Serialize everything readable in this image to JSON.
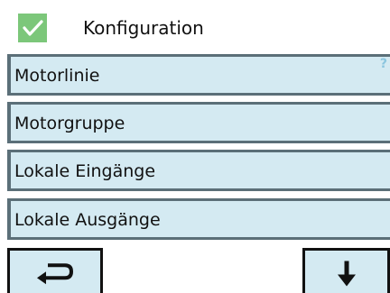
{
  "header": {
    "title": "Konfiguration",
    "check_icon": "checkmark-icon",
    "check_color": "#7cc77a"
  },
  "menu": {
    "items": [
      {
        "label": "Motorlinie",
        "help": "?"
      },
      {
        "label": "Motorgruppe"
      },
      {
        "label": "Lokale Eingänge"
      },
      {
        "label": "Lokale Ausgänge"
      }
    ]
  },
  "footer": {
    "back_icon": "return-arrow-icon",
    "next_icon": "arrow-down-icon"
  },
  "colors": {
    "item_background": "#d4eaf2",
    "item_border": "#5b6f78",
    "help_mark": "#8cc6df"
  }
}
